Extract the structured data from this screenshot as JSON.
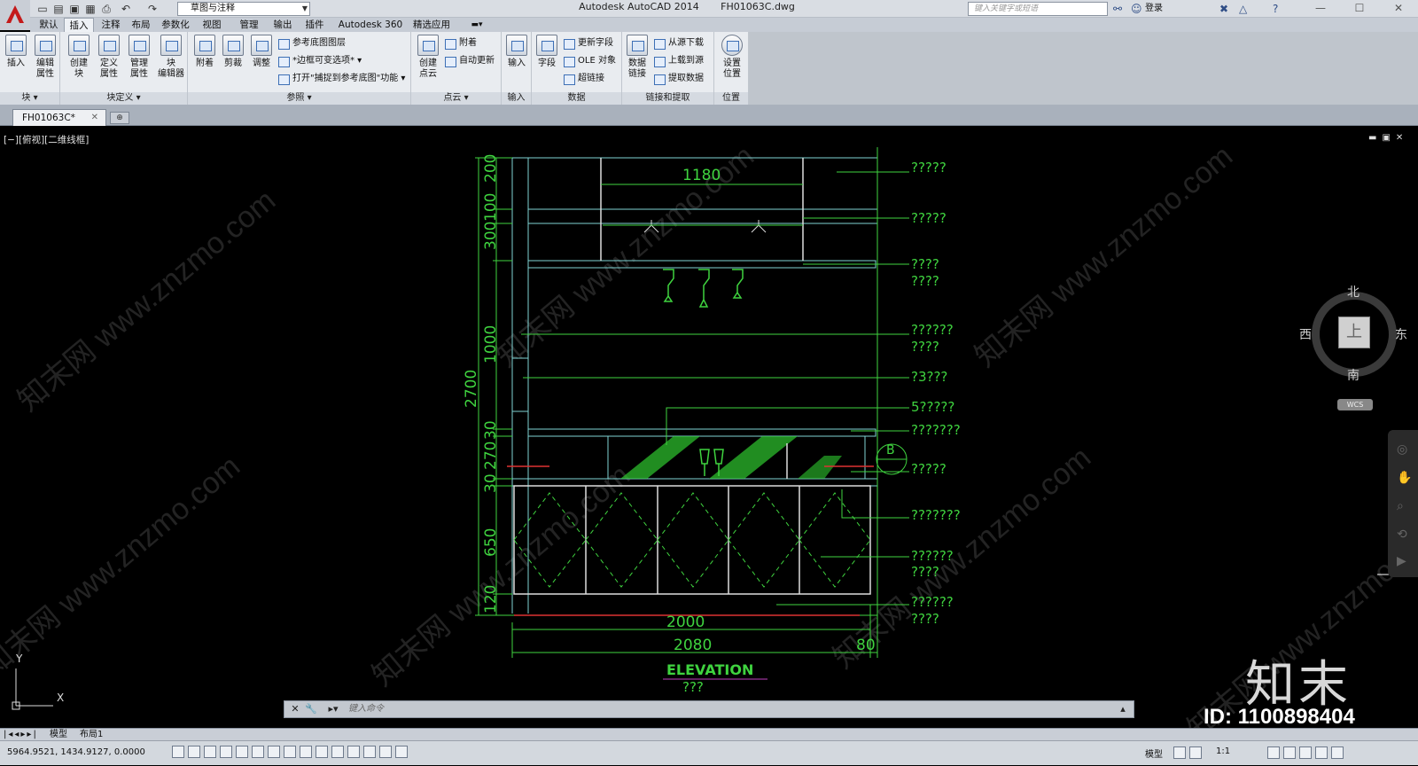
{
  "title_bar": {
    "workspace": "草图与注释",
    "app_name": "Autodesk AutoCAD 2014",
    "file_name": "FH01063C.dwg",
    "search_placeholder": "键入关键字或短语",
    "login": "登录"
  },
  "menu_tabs": [
    "默认",
    "插入",
    "注释",
    "布局",
    "参数化",
    "视图",
    "管理",
    "输出",
    "插件",
    "Autodesk 360",
    "精选应用"
  ],
  "active_tab": "插入",
  "ribbon": {
    "block": {
      "label": "块 ▾",
      "buttons": [
        "插入",
        "编辑\n属性"
      ]
    },
    "block_def": {
      "label": "块定义 ▾",
      "buttons": [
        "创建\n块",
        "定义\n属性",
        "管理\n属性",
        "块\n编辑器"
      ]
    },
    "reference": {
      "label": "参照 ▾",
      "buttons": [
        "附着",
        "剪裁",
        "调整"
      ],
      "small": [
        "参考底图图层",
        "*边框可变选项* ▾",
        "打开\"捕捉到参考底图\"功能 ▾"
      ]
    },
    "point_cloud": {
      "label": "点云 ▾",
      "buttons": [
        "创建\n点云"
      ],
      "small": [
        "附着",
        "自动更新"
      ]
    },
    "import": {
      "label": "输入",
      "buttons": [
        "输入"
      ]
    },
    "data": {
      "label": "数据",
      "buttons": [
        "字段"
      ],
      "small": [
        "更新字段",
        "OLE 对象",
        "超链接"
      ]
    },
    "link": {
      "label": "链接和提取",
      "buttons": [
        "数据\n链接"
      ],
      "small": [
        "从源下载",
        "上载到源",
        "提取数据"
      ]
    },
    "location": {
      "label": "位置",
      "buttons": [
        "设置\n位置"
      ]
    }
  },
  "doc_tab": "FH01063C*",
  "viewport_label": "[−][俯视][二维线框]",
  "viewcube": {
    "north": "北",
    "south": "南",
    "east": "东",
    "west": "西",
    "face": "上",
    "wcs": "WCS"
  },
  "drawing": {
    "dim_top": "1180",
    "dim_left": [
      "200",
      "100",
      "300",
      "1000",
      "2700",
      "30",
      "270",
      "30",
      "650",
      "120"
    ],
    "dim_bottom_inner": "2000",
    "dim_bottom_total": "2080",
    "dim_bottom_right": "80",
    "annotations": [
      "?????",
      "?????",
      "????",
      "????",
      "??????",
      "????",
      "?3???",
      "5?????",
      "???????",
      "?????",
      "???????",
      "??????",
      "????",
      "??????",
      "????"
    ],
    "marker": "B",
    "title": "ELEVATION",
    "subtitle": "???"
  },
  "command_line": {
    "placeholder": "键入命令"
  },
  "layout_tabs": [
    "模型",
    "布局1"
  ],
  "status": {
    "coords": "5964.9521, 1434.9127, 0.0000",
    "model": "模型",
    "scale": "1:1"
  },
  "watermark": {
    "logo": "知末",
    "id": "ID: 1100898404",
    "site": "知末网 www.znzmo.com"
  }
}
